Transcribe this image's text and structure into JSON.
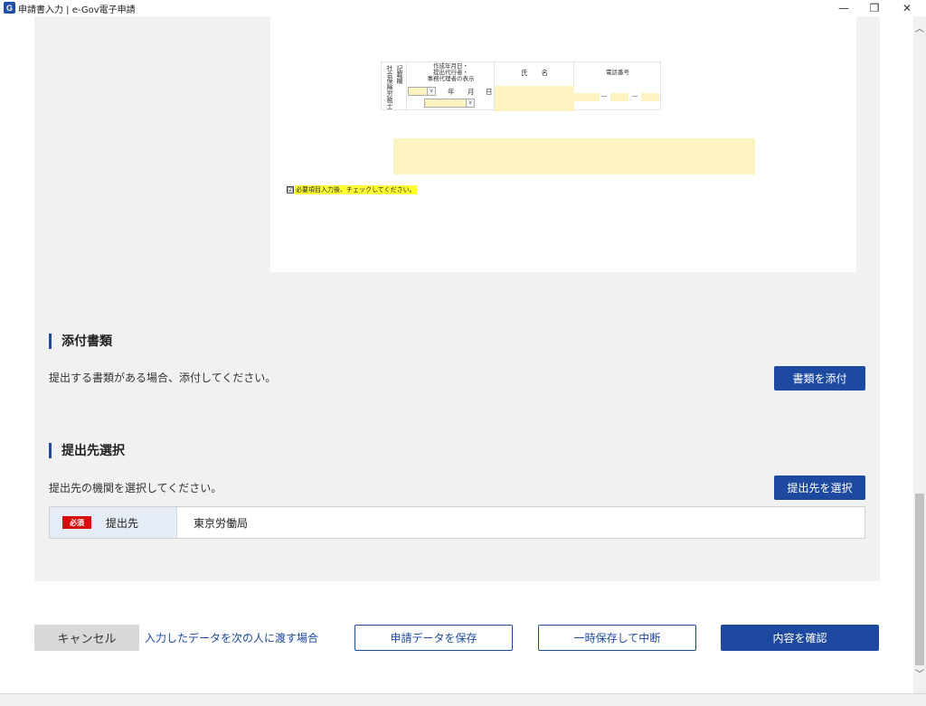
{
  "window": {
    "app_icon": "G",
    "title": "申請書入力 | e-Gov電子申請",
    "minimize_glyph": "—",
    "maximize_glyph": "❐",
    "close_glyph": "✕"
  },
  "form_preview": {
    "vertical_label_1": "社会保険労務士",
    "vertical_label_2": "記載欄",
    "header_date": "作成年月日・\n提出代行者・\n事務代理者の表示",
    "header_name": "氏　　名",
    "header_phone": "電話番号",
    "year_label": "年",
    "month_label": "月",
    "day_label": "日",
    "phone_sep_1": "―",
    "phone_sep_2": "―",
    "checkbox_mark": "☑",
    "checkbox_text": "必要項目入力後、チェックしてください。"
  },
  "attachments": {
    "heading": "添付書類",
    "description": "提出する書類がある場合、添付してください。",
    "attach_button": "書類を添付"
  },
  "destination": {
    "heading": "提出先選択",
    "description": "提出先の機関を選択してください。",
    "select_button": "提出先を選択",
    "required_badge": "必須",
    "field_label": "提出先",
    "field_value": "東京労働局"
  },
  "footer": {
    "cancel_button": "キャンセル",
    "pass_link": "入力したデータを次の人に渡す場合",
    "save_button": "申請データを保存",
    "suspend_button": "一時保存して中断",
    "confirm_button": "内容を確認"
  },
  "scrollbar": {
    "up_glyph": "︿",
    "down_glyph": "﹀"
  },
  "colors": {
    "accent": "#1d4aa0",
    "required": "#d70c0c",
    "input_fill": "#fdf3c0",
    "highlight": "#ffff33",
    "panel_bg": "#f1f1f1"
  }
}
